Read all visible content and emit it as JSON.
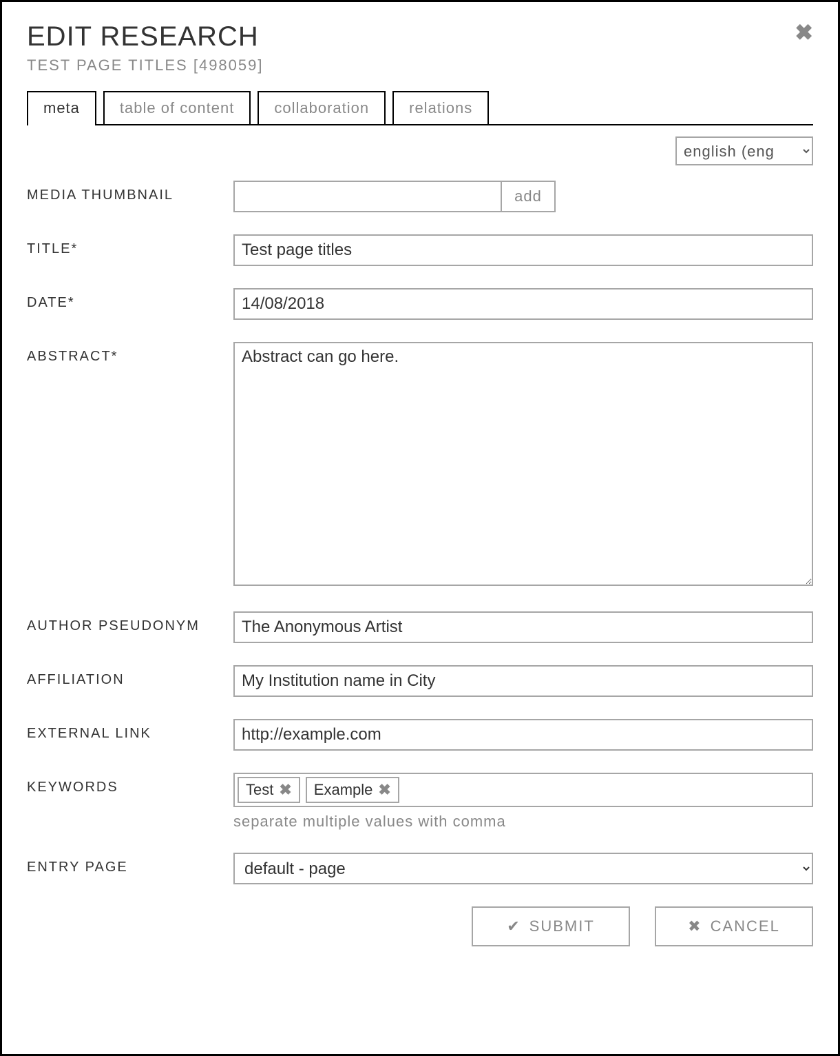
{
  "header": {
    "title": "EDIT RESEARCH",
    "subtitle": "TEST PAGE TITLES [498059]",
    "close_icon": "✖"
  },
  "tabs": [
    {
      "label": "meta",
      "active": true
    },
    {
      "label": "table of content",
      "active": false
    },
    {
      "label": "collaboration",
      "active": false
    },
    {
      "label": "relations",
      "active": false
    }
  ],
  "language": {
    "selected": "english (eng"
  },
  "form": {
    "media_thumbnail": {
      "label": "MEDIA THUMBNAIL",
      "value": "",
      "add_label": "add"
    },
    "title": {
      "label": "TITLE*",
      "value": "Test page titles"
    },
    "date": {
      "label": "DATE*",
      "value": "14/08/2018"
    },
    "abstract": {
      "label": "ABSTRACT*",
      "value": "Abstract can go here."
    },
    "author_pseudonym": {
      "label": "AUTHOR PSEUDONYM",
      "value": "The Anonymous Artist"
    },
    "affiliation": {
      "label": "AFFILIATION",
      "value": "My Institution name in City"
    },
    "external_link": {
      "label": "EXTERNAL LINK",
      "value": "http://example.com"
    },
    "keywords": {
      "label": "KEYWORDS",
      "values": [
        "Test",
        "Example"
      ],
      "helper": "separate multiple values with comma"
    },
    "entry_page": {
      "label": "ENTRY PAGE",
      "selected": "default - page"
    }
  },
  "buttons": {
    "submit": "SUBMIT",
    "cancel": "CANCEL"
  },
  "icons": {
    "check": "✔",
    "x": "✖"
  }
}
